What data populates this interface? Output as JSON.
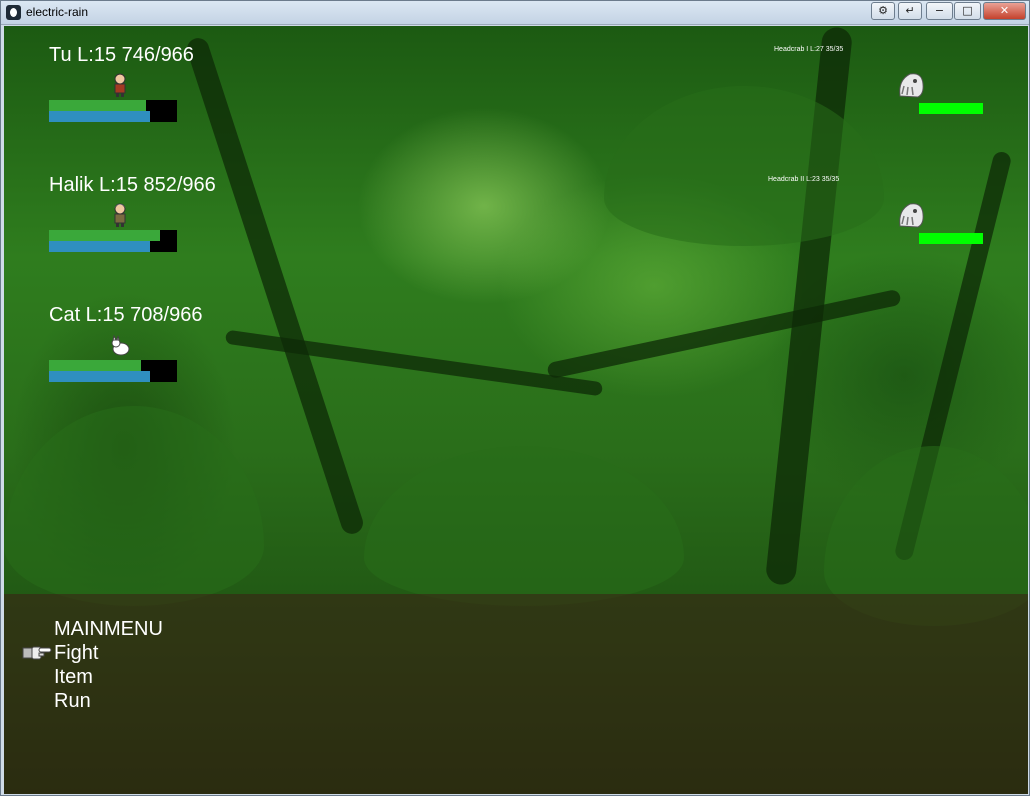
{
  "window": {
    "title": "electric-rain",
    "controls": [
      "⚙",
      "↵",
      "−",
      "□",
      "✕"
    ]
  },
  "party": [
    {
      "name": "Tu",
      "status": "Tu L:15 746/966",
      "hp_fraction": 0.76,
      "mp_fraction": 0.79,
      "sprite": "swordsman-sprite"
    },
    {
      "name": "Halik",
      "status": "Halik L:15 852/966",
      "hp_fraction": 0.87,
      "mp_fraction": 0.79,
      "sprite": "warrior-sprite"
    },
    {
      "name": "Cat",
      "status": "Cat L:15 708/966",
      "hp_fraction": 0.72,
      "mp_fraction": 0.79,
      "sprite": "cat-sprite"
    }
  ],
  "enemies": [
    {
      "label": "Headcrab I L:27 35/35",
      "hp_fraction": 1.0,
      "sprite": "headcrab-sprite"
    },
    {
      "label": "Headcrab II L:23 35/35",
      "hp_fraction": 1.0,
      "sprite": "headcrab-sprite"
    }
  ],
  "menu": {
    "title": "MAINMENU",
    "items": [
      "Fight",
      "Item",
      "Run"
    ],
    "selected_index": 0,
    "cursor_icon": "pointing-hand-icon"
  },
  "colors": {
    "hp_bar": "#3aa83a",
    "mp_bar": "#2f8fbf",
    "enemy_hp_bar": "#00ff00",
    "menu_panel": "rgba(60,30,20,0.55)"
  }
}
